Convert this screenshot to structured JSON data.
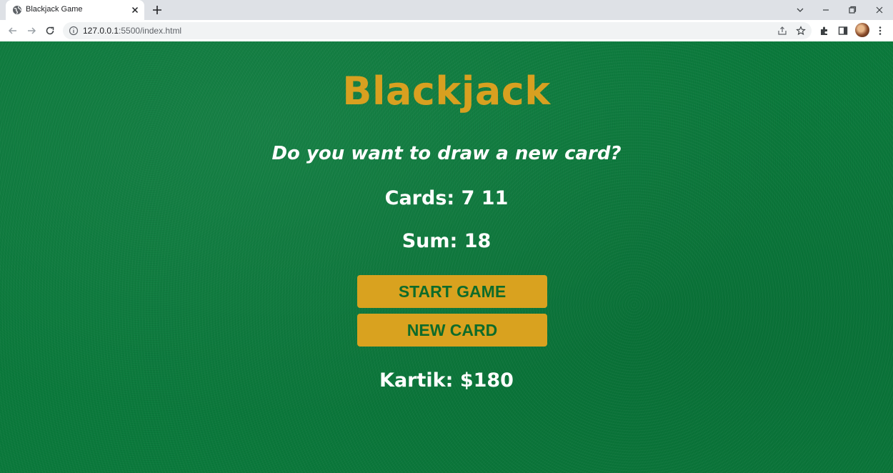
{
  "browser": {
    "tab_title": "Blackjack Game",
    "url_host": "127.0.0.1",
    "url_rest": ":5500/index.html"
  },
  "game": {
    "title": "Blackjack",
    "message": "Do you want to draw a new card?",
    "cards_label": "Cards:",
    "cards": "7 11",
    "sum_label": "Sum:",
    "sum": "18",
    "start_button": "START GAME",
    "new_card_button": "NEW CARD",
    "player_name": "Kartik:",
    "player_chips": "$180"
  },
  "colors": {
    "felt_green": "#0b7a3c",
    "title_gold": "#d8a020",
    "button_gold": "#d9a21f",
    "button_text": "#0e6b2a"
  }
}
